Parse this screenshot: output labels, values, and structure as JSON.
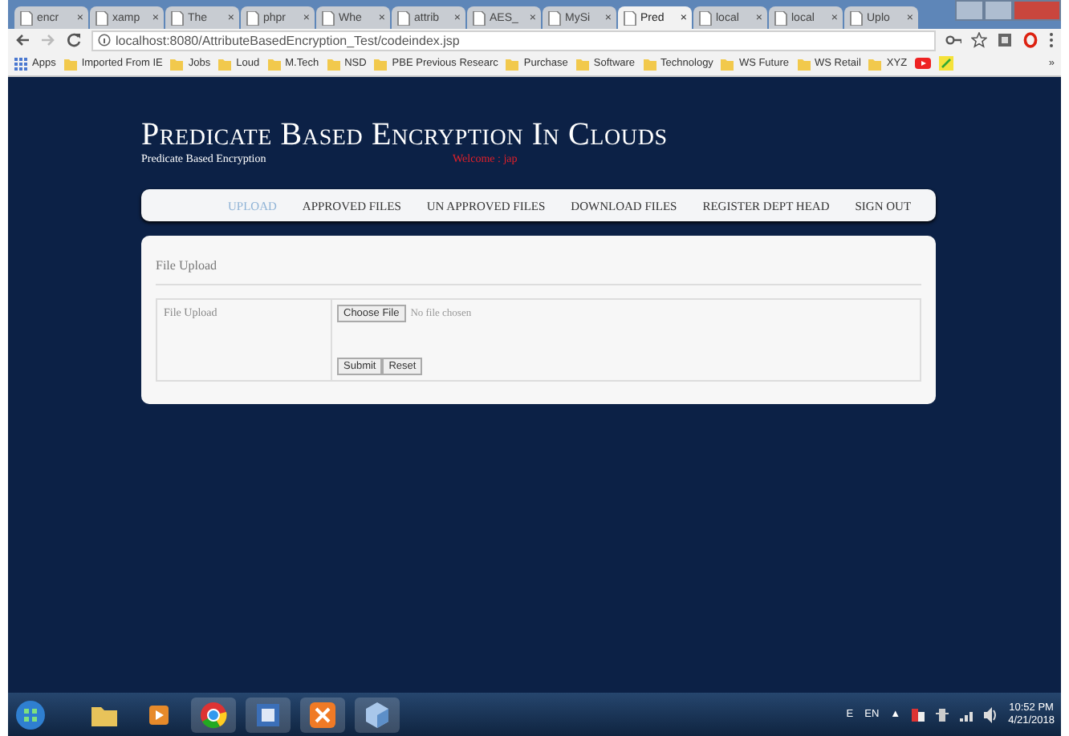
{
  "browser": {
    "tabs": [
      {
        "label": "encr",
        "selected": false
      },
      {
        "label": "xamp",
        "selected": false
      },
      {
        "label": "The",
        "selected": false
      },
      {
        "label": "phpr",
        "selected": false
      },
      {
        "label": "Whe",
        "selected": false
      },
      {
        "label": "attrib",
        "selected": false
      },
      {
        "label": "AES_",
        "selected": false
      },
      {
        "label": "MySi",
        "selected": false
      },
      {
        "label": "Pred",
        "selected": true
      },
      {
        "label": "local",
        "selected": false
      },
      {
        "label": "local",
        "selected": false
      },
      {
        "label": "Uplo",
        "selected": false
      }
    ],
    "close_glyph": "×",
    "url": "localhost:8080/AttributeBasedEncryption_Test/codeindex.jsp",
    "bookmarks": [
      "Apps",
      "Imported From IE",
      "Jobs",
      "Loud",
      "M.Tech",
      "NSD",
      "PBE Previous Researc",
      "Purchase",
      "Software",
      "Technology",
      "WS Future",
      "WS Retail",
      "XYZ"
    ],
    "more": "»"
  },
  "page": {
    "title": "Predicate Based Encryption In Clouds",
    "subtitle": "Predicate Based Encryption",
    "welcome": "Welcome : jap",
    "nav": [
      {
        "label": "UPLOAD",
        "selected": true
      },
      {
        "label": "APPROVED FILES",
        "selected": false
      },
      {
        "label": "UN APPROVED FILES",
        "selected": false
      },
      {
        "label": "DOWNLOAD FILES",
        "selected": false
      },
      {
        "label": "REGISTER DEPT HEAD",
        "selected": false
      },
      {
        "label": "SIGN OUT",
        "selected": false
      }
    ],
    "form": {
      "heading": "File Upload",
      "label": "File Upload",
      "choose_button": "Choose File",
      "file_status": "No file chosen",
      "buttons": [
        "Submit",
        "Reset"
      ]
    }
  },
  "taskbar": {
    "tray": [
      "E",
      "EN",
      "▲"
    ],
    "time": "10:52 PM",
    "date": "4/21/2018"
  }
}
